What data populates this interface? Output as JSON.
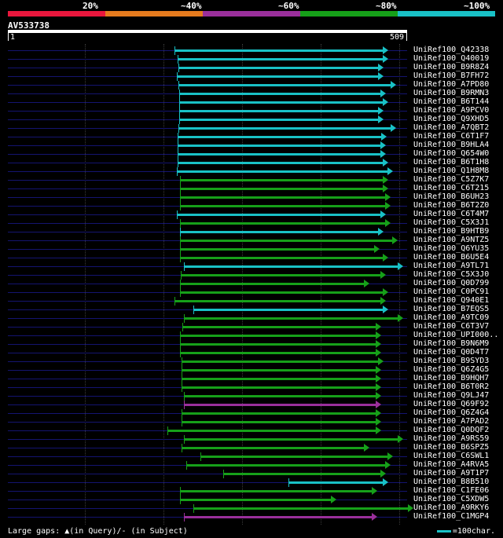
{
  "legend": {
    "labels": [
      "20%",
      "~40%",
      "~60%",
      "~80%",
      "~100%"
    ],
    "colors": [
      "#e9173d",
      "#e67b1e",
      "#9a2f9b",
      "#16a019",
      "#19c1c6"
    ]
  },
  "query": {
    "name": "AV533738",
    "start_label": "1",
    "end_label": "509",
    "length": 509
  },
  "hits": [
    {
      "name": "UniRef100_Q42338",
      "start": 212,
      "end": 478,
      "color": "cyan"
    },
    {
      "name": "UniRef100_Q40019",
      "start": 216,
      "end": 478,
      "color": "cyan"
    },
    {
      "name": "UniRef100_B9R8Z4",
      "start": 217,
      "end": 472,
      "color": "cyan"
    },
    {
      "name": "UniRef100_B7FH72",
      "start": 215,
      "end": 472,
      "color": "cyan"
    },
    {
      "name": "UniRef100_A7PD80",
      "start": 217,
      "end": 488,
      "color": "cyan"
    },
    {
      "name": "UniRef100_B9RMN3",
      "start": 218,
      "end": 475,
      "color": "cyan"
    },
    {
      "name": "UniRef100_B6T144",
      "start": 218,
      "end": 478,
      "color": "cyan"
    },
    {
      "name": "UniRef100_A9PCV0",
      "start": 218,
      "end": 472,
      "color": "cyan"
    },
    {
      "name": "UniRef100_Q9XHD5",
      "start": 218,
      "end": 472,
      "color": "cyan"
    },
    {
      "name": "UniRef100_A7QBT2",
      "start": 217,
      "end": 488,
      "color": "cyan"
    },
    {
      "name": "UniRef100_C6T1F7",
      "start": 216,
      "end": 476,
      "color": "cyan"
    },
    {
      "name": "UniRef100_B9HLA4",
      "start": 216,
      "end": 475,
      "color": "cyan"
    },
    {
      "name": "UniRef100_Q654W0",
      "start": 216,
      "end": 475,
      "color": "cyan"
    },
    {
      "name": "UniRef100_B6T1H8",
      "start": 216,
      "end": 478,
      "color": "cyan"
    },
    {
      "name": "UniRef100_Q1H8M8",
      "start": 215,
      "end": 484,
      "color": "cyan"
    },
    {
      "name": "UniRef100_C5Z7K7",
      "start": 219,
      "end": 478,
      "color": "green"
    },
    {
      "name": "UniRef100_C6T215",
      "start": 219,
      "end": 478,
      "color": "green"
    },
    {
      "name": "UniRef100_B6UH23",
      "start": 219,
      "end": 481,
      "color": "green"
    },
    {
      "name": "UniRef100_B6T2Z0",
      "start": 219,
      "end": 481,
      "color": "green"
    },
    {
      "name": "UniRef100_C6T4M7",
      "start": 215,
      "end": 475,
      "color": "cyan"
    },
    {
      "name": "UniRef100_C5X3J1",
      "start": 219,
      "end": 481,
      "color": "green"
    },
    {
      "name": "UniRef100_B9HTB9",
      "start": 219,
      "end": 472,
      "color": "cyan"
    },
    {
      "name": "UniRef100_A9NTZ5",
      "start": 219,
      "end": 490,
      "color": "green"
    },
    {
      "name": "UniRef100_Q6YU35",
      "start": 219,
      "end": 467,
      "color": "green"
    },
    {
      "name": "UniRef100_B6U5E4",
      "start": 219,
      "end": 478,
      "color": "green"
    },
    {
      "name": "UniRef100_A9TL71",
      "start": 224,
      "end": 497,
      "color": "cyan"
    },
    {
      "name": "UniRef100_C5X3J0",
      "start": 220,
      "end": 475,
      "color": "green"
    },
    {
      "name": "UniRef100_Q0D799",
      "start": 219,
      "end": 454,
      "color": "green"
    },
    {
      "name": "UniRef100_C0PC91",
      "start": 219,
      "end": 478,
      "color": "green"
    },
    {
      "name": "UniRef100_Q940E1",
      "start": 212,
      "end": 475,
      "color": "green"
    },
    {
      "name": "UniRef100_B7EQS5",
      "start": 236,
      "end": 478,
      "color": "cyan"
    },
    {
      "name": "UniRef100_A9TC09",
      "start": 224,
      "end": 497,
      "color": "green"
    },
    {
      "name": "UniRef100_C6T3V7",
      "start": 222,
      "end": 469,
      "color": "green"
    },
    {
      "name": "UniRef100_UPI000..",
      "start": 219,
      "end": 469,
      "color": "green"
    },
    {
      "name": "UniRef100_B9N6M9",
      "start": 219,
      "end": 469,
      "color": "green"
    },
    {
      "name": "UniRef100_Q0D4T7",
      "start": 219,
      "end": 469,
      "color": "green"
    },
    {
      "name": "UniRef100_B9SYD3",
      "start": 221,
      "end": 472,
      "color": "green"
    },
    {
      "name": "UniRef100_Q6Z4G5",
      "start": 221,
      "end": 469,
      "color": "green"
    },
    {
      "name": "UniRef100_B9HQH7",
      "start": 221,
      "end": 469,
      "color": "green"
    },
    {
      "name": "UniRef100_B6T0R2",
      "start": 221,
      "end": 469,
      "color": "green"
    },
    {
      "name": "UniRef100_Q9LJ47",
      "start": 224,
      "end": 469,
      "color": "green"
    },
    {
      "name": "UniRef100_Q69F92",
      "start": 224,
      "end": 469,
      "color": "purple"
    },
    {
      "name": "UniRef100_Q6Z4G4",
      "start": 221,
      "end": 469,
      "color": "green"
    },
    {
      "name": "UniRef100_A7PAD2",
      "start": 221,
      "end": 469,
      "color": "green"
    },
    {
      "name": "UniRef100_Q0DQF2",
      "start": 203,
      "end": 469,
      "color": "green"
    },
    {
      "name": "UniRef100_A9RS59",
      "start": 224,
      "end": 497,
      "color": "green"
    },
    {
      "name": "UniRef100_B6SPZ5",
      "start": 221,
      "end": 454,
      "color": "green"
    },
    {
      "name": "UniRef100_C6SWL1",
      "start": 245,
      "end": 484,
      "color": "green"
    },
    {
      "name": "UniRef100_A4RVA5",
      "start": 227,
      "end": 481,
      "color": "green"
    },
    {
      "name": "UniRef100_A9T1P7",
      "start": 275,
      "end": 475,
      "color": "green"
    },
    {
      "name": "UniRef100_B8B510",
      "start": 358,
      "end": 478,
      "color": "cyan"
    },
    {
      "name": "UniRef100_C1FE06",
      "start": 219,
      "end": 464,
      "color": "green"
    },
    {
      "name": "UniRef100_C5XDW5",
      "start": 219,
      "end": 412,
      "color": "green"
    },
    {
      "name": "UniRef100_A9RKY6",
      "start": 236,
      "end": 510,
      "color": "green"
    },
    {
      "name": "UniRef100_C1MGP4",
      "start": 224,
      "end": 464,
      "color": "purple"
    }
  ],
  "footer": {
    "large_gaps": "Large gaps: ▲(in Query)/- (in Subject)",
    "scale": "=100char."
  }
}
